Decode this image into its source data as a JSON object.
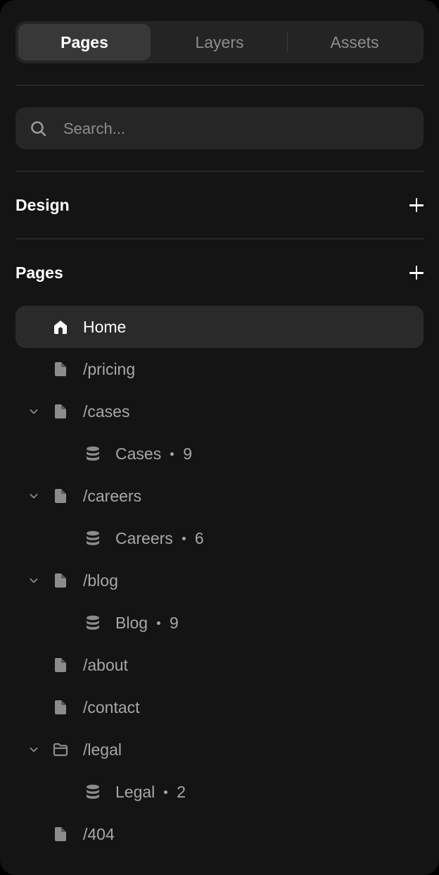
{
  "tabs": [
    {
      "label": "Pages",
      "active": true
    },
    {
      "label": "Layers",
      "active": false
    },
    {
      "label": "Assets",
      "active": false
    }
  ],
  "search": {
    "placeholder": "Search...",
    "value": "",
    "icon": "search-icon"
  },
  "sections": {
    "design": {
      "title": "Design",
      "add_icon": "plus-icon"
    },
    "pages": {
      "title": "Pages",
      "add_icon": "plus-icon"
    }
  },
  "pages": [
    {
      "label": "Home",
      "icon": "home-icon",
      "selected": true
    },
    {
      "label": "/pricing",
      "icon": "page-icon"
    },
    {
      "label": "/cases",
      "icon": "page-icon",
      "expanded": true
    },
    {
      "label": "Cases",
      "icon": "database-icon",
      "count": "9",
      "child": true
    },
    {
      "label": "/careers",
      "icon": "page-icon",
      "expanded": true
    },
    {
      "label": "Careers",
      "icon": "database-icon",
      "count": "6",
      "child": true
    },
    {
      "label": "/blog",
      "icon": "page-icon",
      "expanded": true
    },
    {
      "label": "Blog",
      "icon": "database-icon",
      "count": "9",
      "child": true
    },
    {
      "label": "/about",
      "icon": "page-icon"
    },
    {
      "label": "/contact",
      "icon": "page-icon"
    },
    {
      "label": "/legal",
      "icon": "folder-icon",
      "expanded": true
    },
    {
      "label": "Legal",
      "icon": "database-icon",
      "count": "2",
      "child": true
    },
    {
      "label": "/404",
      "icon": "page-icon"
    }
  ],
  "colors": {
    "background": "#141414",
    "surface": "#262626",
    "active_row": "#2a2a2a",
    "text_primary": "#ffffff",
    "text_secondary": "#a7a7a7",
    "icon": "#8c8c8c"
  }
}
